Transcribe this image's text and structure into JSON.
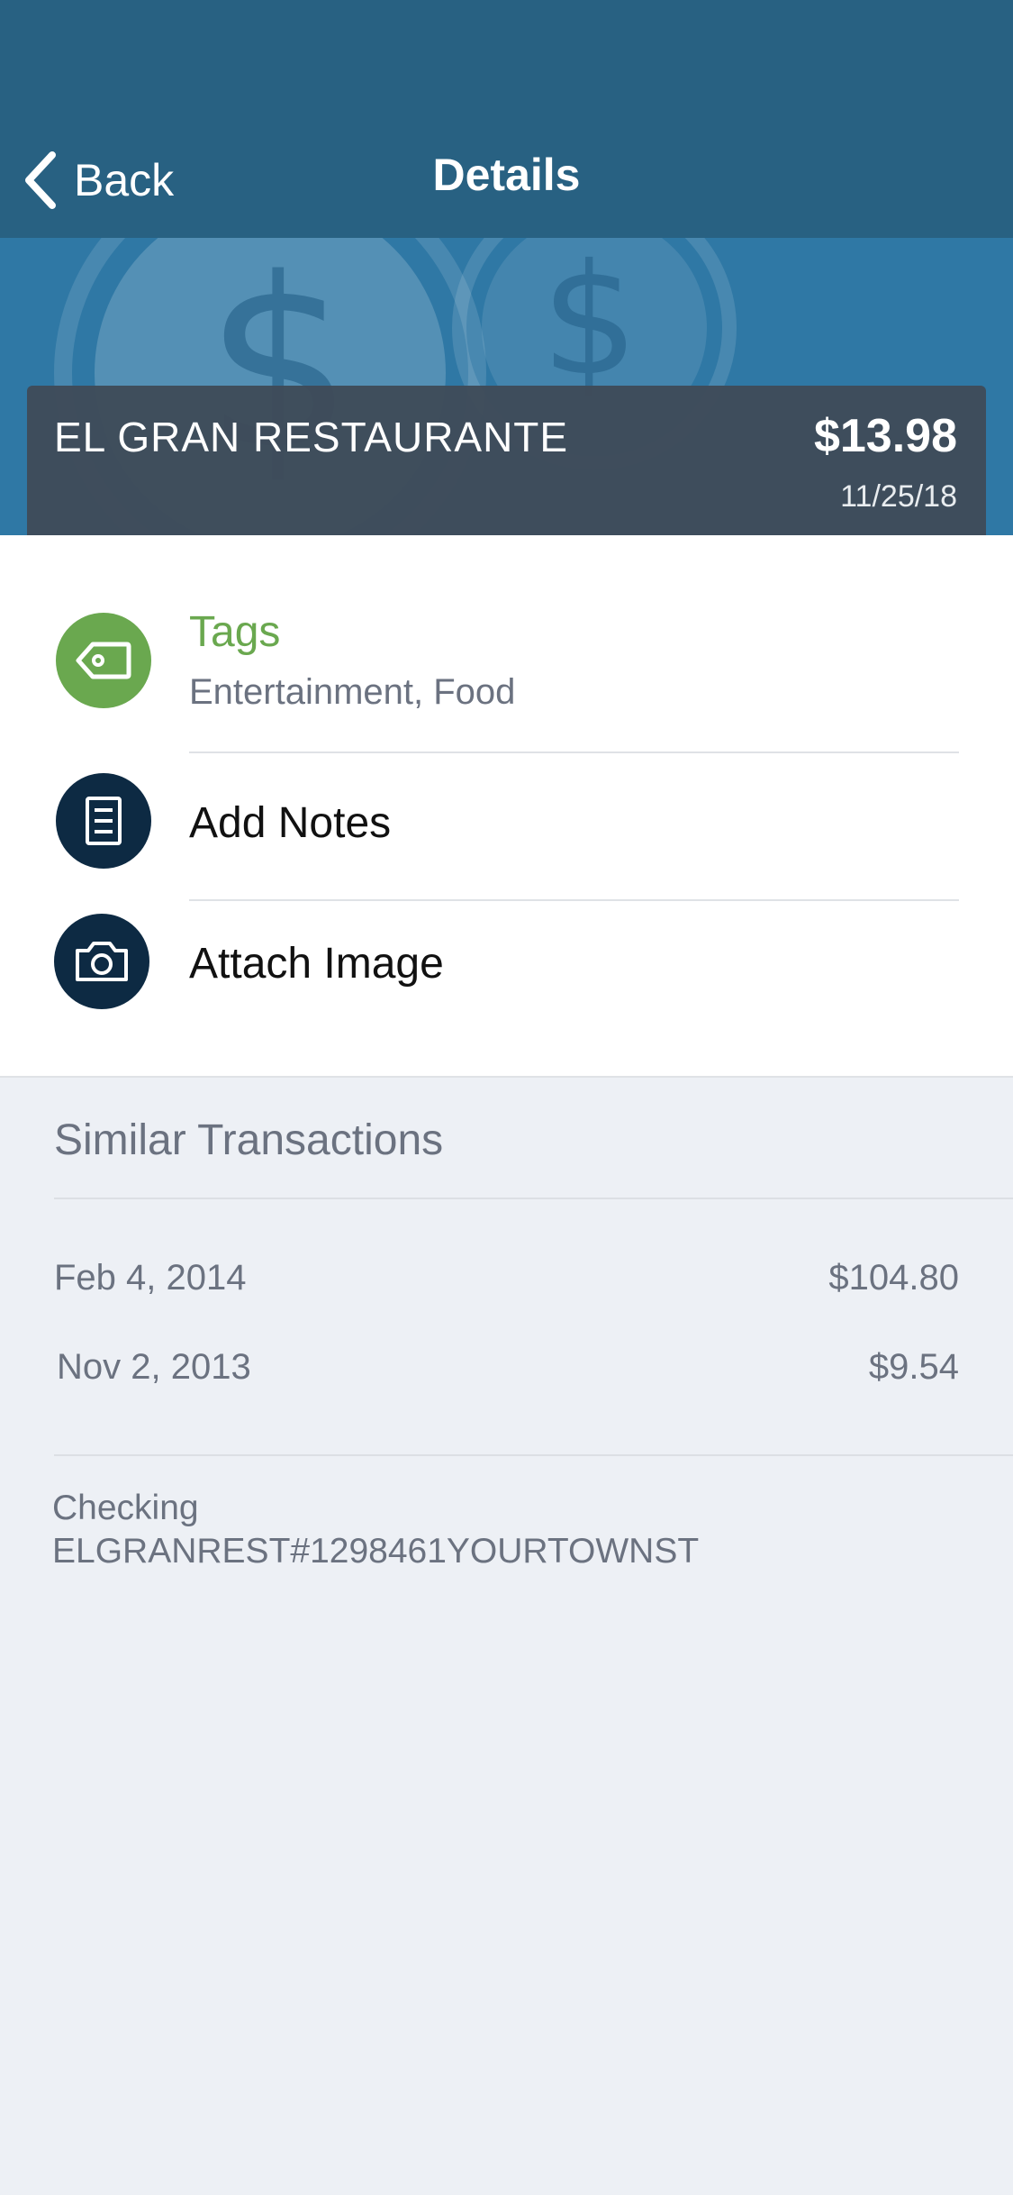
{
  "nav": {
    "back_label": "Back",
    "title": "Details"
  },
  "merchant": {
    "name": "EL GRAN RESTAURANTE",
    "amount": "$13.98",
    "date": "11/25/18"
  },
  "actions": {
    "tags": {
      "title": "Tags",
      "value": "Entertainment, Food",
      "icon": "tag-icon",
      "color": "#6aa84f"
    },
    "notes": {
      "title": "Add Notes",
      "icon": "notes-icon"
    },
    "image": {
      "title": "Attach Image",
      "icon": "camera-icon"
    }
  },
  "similar": {
    "heading": "Similar Transactions",
    "rows": [
      {
        "date": "Feb 4, 2014",
        "amount": "$104.80"
      },
      {
        "date": "Nov 2, 2013",
        "amount": "$9.54"
      }
    ]
  },
  "account": {
    "type": "Checking",
    "description": "ELGRANREST#1298461YOURTOWNST"
  },
  "colors": {
    "nav_bg": "#286182",
    "hero_bg": "#2f78a5",
    "accent_green": "#6aa84f",
    "icon_navy": "#0d2a43",
    "page_bg": "#edf0f5"
  }
}
